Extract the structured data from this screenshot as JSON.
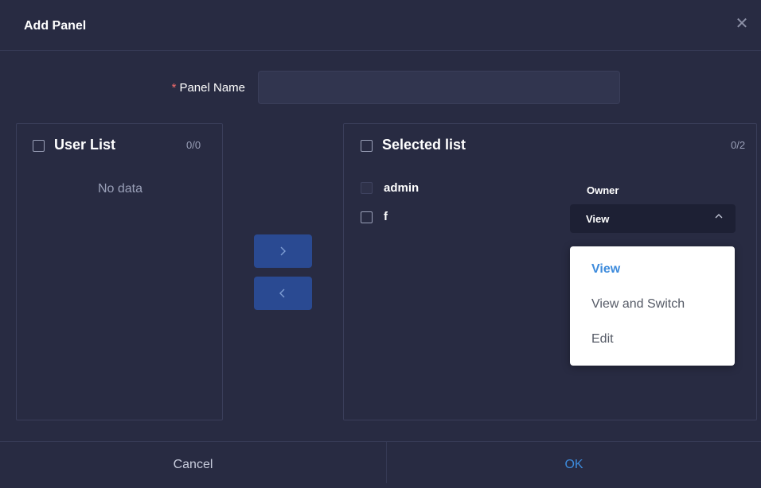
{
  "dialog": {
    "title": "Add Panel",
    "close_icon": "close-icon",
    "panel_name_required_mark": "*",
    "panel_name_label": "Panel Name",
    "panel_name_value": "",
    "panel_name_placeholder": ""
  },
  "user_list": {
    "title": "User List",
    "count": "0/0",
    "empty_text": "No data"
  },
  "transfer": {
    "to_right_icon": "chevron-right-icon",
    "to_left_icon": "chevron-left-icon"
  },
  "selected_list": {
    "title": "Selected list",
    "count": "0/2",
    "items": [
      {
        "label": "admin",
        "role": "Owner",
        "disabled": true
      },
      {
        "label": "f",
        "permission": "View",
        "disabled": false
      }
    ]
  },
  "permission_dropdown": {
    "selected": "View",
    "options": [
      "View",
      "View and Switch",
      "Edit"
    ]
  },
  "footer": {
    "cancel_label": "Cancel",
    "ok_label": "OK"
  },
  "colors": {
    "background": "#282b42",
    "accent": "#3d8bdc",
    "transfer_button": "#2a4a92",
    "required": "#f56c6c"
  }
}
